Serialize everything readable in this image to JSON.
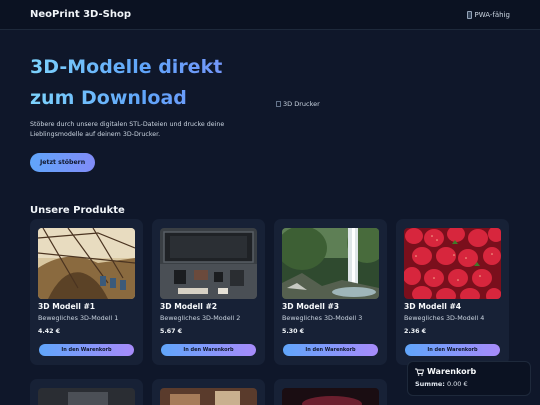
{
  "header": {
    "brand": "NeoPrint 3D-Shop",
    "badge": "PWA-fähig"
  },
  "hero": {
    "title_line1": "3D-Modelle direkt",
    "title_line2": "zum Download",
    "text": "Stöbere durch unsere digitalen STL-Dateien und drucke deine Lieblingsmodelle auf deinem 3D-Drucker.",
    "cta": "Jetzt stöbern",
    "image_alt": "3D Drucker"
  },
  "products_title": "Unsere Produkte",
  "products": [
    {
      "name": "3D Modell #1",
      "desc": "Bewegliches 3D-Modell 1",
      "price": "4.42 €",
      "button": "In den Warenkorb"
    },
    {
      "name": "3D Modell #2",
      "desc": "Bewegliches 3D-Modell 2",
      "price": "5.67 €",
      "button": "In den Warenkorb"
    },
    {
      "name": "3D Modell #3",
      "desc": "Bewegliches 3D-Modell 3",
      "price": "5.30 €",
      "button": "In den Warenkorb"
    },
    {
      "name": "3D Modell #4",
      "desc": "Bewegliches 3D-Modell 4",
      "price": "2.36 €",
      "button": "In den Warenkorb"
    }
  ],
  "cart": {
    "title": "Warenkorb",
    "sum_label": "Summe:",
    "sum_value": "0.00 €",
    "icon": "cart-icon"
  }
}
